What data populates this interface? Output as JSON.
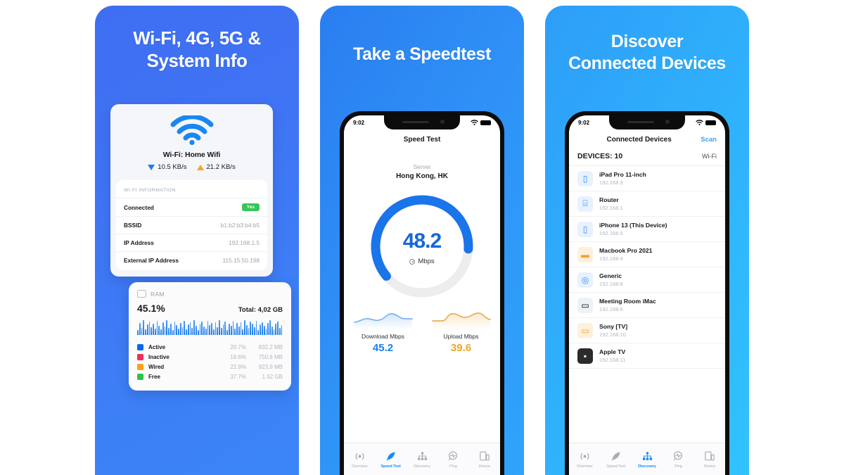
{
  "panels": [
    {
      "headline": "Wi-Fi, 4G, 5G &\nSystem Info",
      "wifi_card": {
        "network": "Wi-Fi: Home Wifi",
        "download_rate": "10.5 KB/s",
        "upload_rate": "21.2 KB/s",
        "section_title": "WI-FI INFORMATION",
        "rows": [
          {
            "key": "Connected",
            "value": "Yes",
            "is_badge": true
          },
          {
            "key": "BSSID",
            "value": "b1:b2:b3:b4:b5",
            "is_badge": false
          },
          {
            "key": "IP Address",
            "value": "192.168.1.5",
            "is_badge": false
          },
          {
            "key": "External IP Address",
            "value": "115.15.50.198",
            "is_badge": false
          }
        ]
      },
      "ram_card": {
        "title": "RAM",
        "percent": "45.1%",
        "total": "Total: 4,02 GB",
        "legend": [
          {
            "name": "Active",
            "pct": "20.7%",
            "value": "832,2 MB",
            "color": "#0a66f0"
          },
          {
            "name": "Inactive",
            "pct": "18.6%",
            "value": "750,6 MB",
            "color": "#f02f56"
          },
          {
            "name": "Wired",
            "pct": "22.9%",
            "value": "923,9 MB",
            "color": "#f8a21a"
          },
          {
            "name": "Free",
            "pct": "37.7%",
            "value": "1.52 GB",
            "color": "#2bc44e"
          }
        ]
      }
    },
    {
      "headline": "Take a Speedtest",
      "status_bar": {
        "time": "9:02",
        "wifi_icon": "wifi-icon",
        "battery_icon": "battery-icon"
      },
      "nav_title": "Speed Test",
      "server_label": "Server",
      "server_name": "Hong Kong, HK",
      "gauge": {
        "value": "48.2",
        "unit": "Mbps",
        "percent": 62,
        "color": "#1a74ea"
      },
      "stats": [
        {
          "label": "Download Mbps",
          "value": "45.2",
          "color": "#1a7ff0"
        },
        {
          "label": "Upload Mbps",
          "value": "39.6",
          "color": "#f0a521"
        }
      ]
    },
    {
      "headline": "Discover\nConnected Devices",
      "status_bar": {
        "time": "9:02",
        "wifi_icon": "wifi-icon",
        "battery_icon": "battery-icon"
      },
      "nav_title": "Connected Devices",
      "scan_label": "Scan",
      "devices_count_label": "DEVICES: 10",
      "connection_label": "Wi-Fi",
      "devices": [
        {
          "name": "iPad Pro 11-inch",
          "ip": "192.168.3",
          "icon": "tablet-icon",
          "glyph": "▯",
          "bg": "#e8f1fe",
          "fg": "#2f8bf6"
        },
        {
          "name": "Router",
          "ip": "192.168.1",
          "icon": "router-icon",
          "glyph": "⌸",
          "bg": "#e8f1fe",
          "fg": "#2f8bf6"
        },
        {
          "name": "iPhone 13 (This Device)",
          "ip": "192.168.5",
          "icon": "phone-icon",
          "glyph": "▯",
          "bg": "#e8f1fe",
          "fg": "#2f8bf6"
        },
        {
          "name": "Macbook Pro 2021",
          "ip": "192.168.4",
          "icon": "laptop-icon",
          "glyph": "▬",
          "bg": "#fdf0dc",
          "fg": "#f3a325"
        },
        {
          "name": "Generic",
          "ip": "192.168.8",
          "icon": "generic-icon",
          "glyph": "◎",
          "bg": "#e8f1fe",
          "fg": "#2f8bf6"
        },
        {
          "name": "Meeting Room iMac",
          "ip": "192.168.6",
          "icon": "imac-icon",
          "glyph": "▭",
          "bg": "#eef2f7",
          "fg": "#5b6personalize"
        },
        {
          "name": "Sony [TV]",
          "ip": "192.168.10",
          "icon": "tv-icon",
          "glyph": "▭",
          "bg": "#fdf0dc",
          "fg": "#f3a325"
        },
        {
          "name": "Apple TV",
          "ip": "192.168.11",
          "icon": "appletv-icon",
          "glyph": "▪",
          "bg": "#2b2b2d",
          "fg": "#ffffff"
        }
      ]
    }
  ],
  "tabs": [
    {
      "label": "Overview",
      "icon": "signal-icon"
    },
    {
      "label": "Speed Test",
      "icon": "rocket-icon"
    },
    {
      "label": "Discovery",
      "icon": "network-icon"
    },
    {
      "label": "Ping",
      "icon": "ping-icon"
    },
    {
      "label": "Device",
      "icon": "device-icon"
    }
  ],
  "active_tab_panel2": "Speed Test",
  "active_tab_panel3": "Discovery"
}
